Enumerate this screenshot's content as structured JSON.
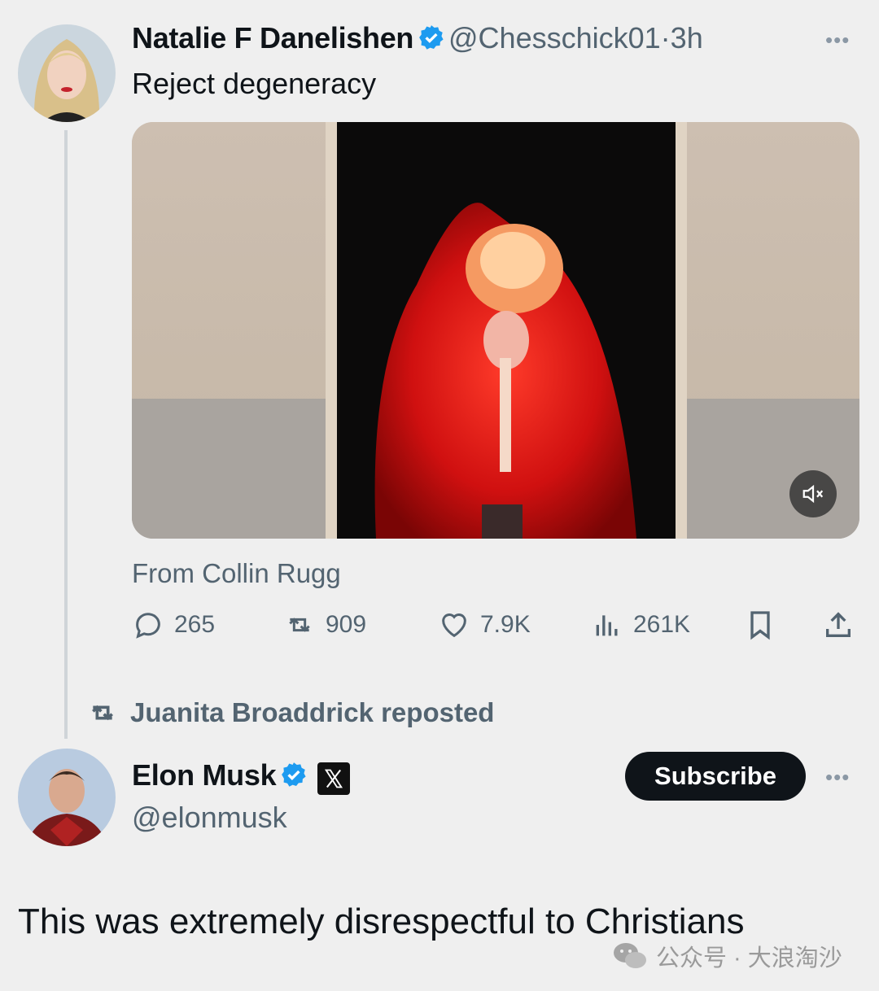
{
  "tweet1": {
    "name": "Natalie F Danelishen",
    "handle": "@Chesschick01",
    "sep": "·",
    "time": "3h",
    "text": "Reject degeneracy",
    "source": "From Collin Rugg",
    "stats": {
      "replies": "265",
      "reposts": "909",
      "likes": "7.9K",
      "views": "261K"
    }
  },
  "repost_notice": "Juanita Broaddrick reposted",
  "tweet2": {
    "name": "Elon Musk",
    "handle": "@elonmusk",
    "subscribe_label": "Subscribe",
    "text": "This was extremely disrespectful to Christians"
  },
  "watermark": "公众号 · 大浪淘沙",
  "colors": {
    "verified": "#1d9bf0",
    "text": "#0f1419",
    "muted": "#536471",
    "background": "#efefef"
  },
  "icons": [
    "verified-badge-icon",
    "more-icon",
    "mute-icon",
    "reply-icon",
    "repost-icon",
    "like-icon",
    "views-icon",
    "bookmark-icon",
    "share-icon",
    "x-logo-icon",
    "wechat-icon"
  ]
}
